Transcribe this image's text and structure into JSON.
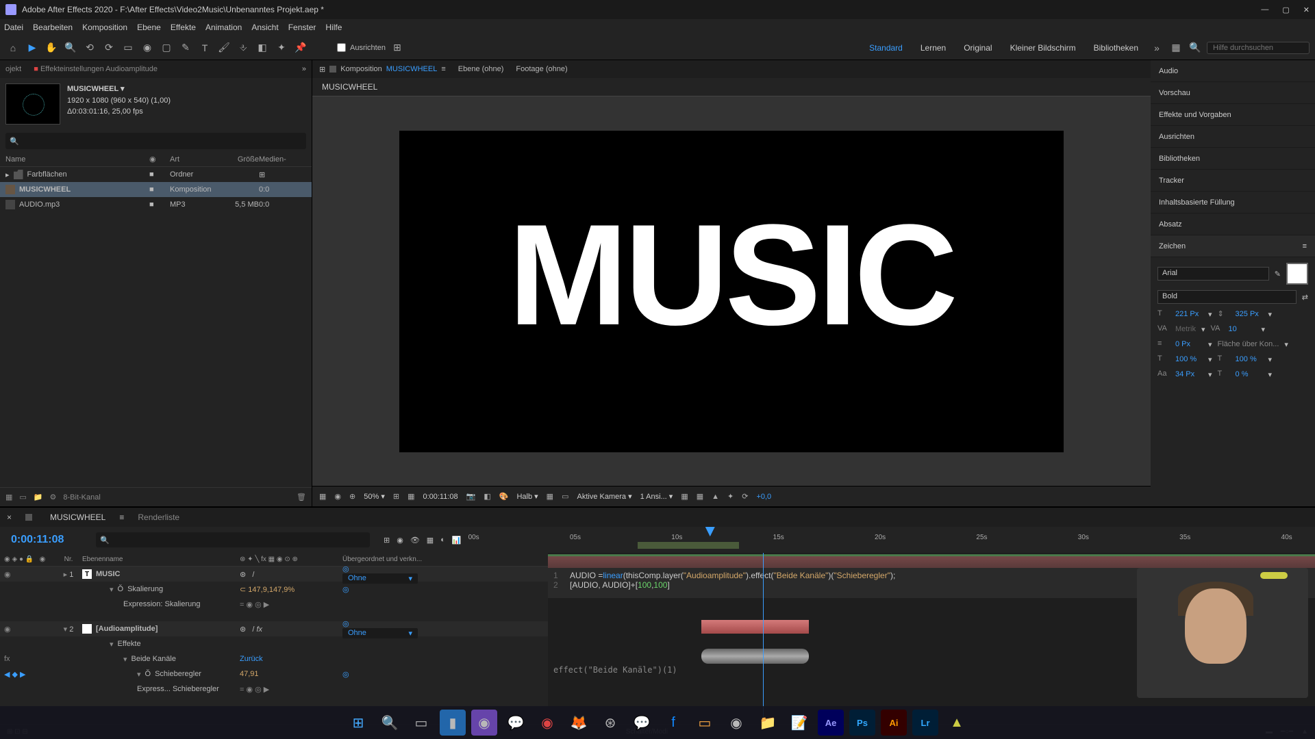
{
  "titlebar": {
    "app": "Adobe After Effects 2020",
    "file": "F:\\After Effects\\Video2Music\\Unbenanntes Projekt.aep *"
  },
  "menu": [
    "Datei",
    "Bearbeiten",
    "Komposition",
    "Ebene",
    "Effekte",
    "Animation",
    "Ansicht",
    "Fenster",
    "Hilfe"
  ],
  "toolbar": {
    "align": "Ausrichten",
    "workspaces": [
      "Standard",
      "Lernen",
      "Original",
      "Kleiner Bildschirm",
      "Bibliotheken"
    ],
    "active_ws": "Standard",
    "search_ph": "Hilfe durchsuchen"
  },
  "left": {
    "tabs": {
      "project": "ojekt",
      "fx": "Effekteinstellungen Audioamplitude"
    },
    "comp_name": "MUSICWHEEL",
    "comp_dims": "1920 x 1080 (960 x 540) (1,00)",
    "comp_dur": "Δ0:03:01:16, 25,00 fps",
    "cols": {
      "name": "Name",
      "type": "Art",
      "size": "Größe",
      "media": "Medien-"
    },
    "rows": [
      {
        "name": "Farbflächen",
        "type": "Ordner",
        "size": "",
        "media": "",
        "kind": "folder"
      },
      {
        "name": "MUSICWHEEL",
        "type": "Komposition",
        "size": "",
        "media": "0:0",
        "kind": "comp",
        "sel": true
      },
      {
        "name": "AUDIO.mp3",
        "type": "MP3",
        "size": "5,5 MB",
        "media": "0:0",
        "kind": "mp3"
      }
    ],
    "footer_depth": "8-Bit-Kanal"
  },
  "center": {
    "tab_comp_label": "Komposition",
    "tab_comp_name": "MUSICWHEEL",
    "tab_layer": "Ebene (ohne)",
    "tab_footage": "Footage (ohne)",
    "subtab": "MUSICWHEEL",
    "viewer_text": "MUSIC",
    "footer": {
      "zoom": "50%",
      "tc": "0:00:11:08",
      "res": "Halb",
      "cam": "Aktive Kamera",
      "views": "1 Ansi...",
      "exp": "+0,0"
    }
  },
  "right": {
    "panels": [
      "Audio",
      "Vorschau",
      "Effekte und Vorgaben",
      "Ausrichten",
      "Bibliotheken",
      "Tracker",
      "Inhaltsbasierte Füllung",
      "Absatz",
      "Zeichen"
    ],
    "char": {
      "font": "Arial",
      "weight": "Bold",
      "size": "221 Px",
      "leading": "325 Px",
      "kerning": "Metrik",
      "tracking": "10",
      "stroke": "0 Px",
      "fill_label": "Fläche über Kon...",
      "hscale": "100 %",
      "vscale": "100 %",
      "baseline": "34 Px",
      "tsume": "0 %"
    }
  },
  "timeline": {
    "tabs": {
      "comp": "MUSICWHEEL",
      "render": "Renderliste"
    },
    "tc": "0:00:11:08",
    "ticks": [
      "00s",
      "05s",
      "10s",
      "15s",
      "20s",
      "25s",
      "30s",
      "35s",
      "40s"
    ],
    "cols": {
      "nr": "Nr.",
      "name": "Ebenenname",
      "parent": "Übergeordnet und verkn..."
    },
    "layers": {
      "l1": {
        "num": "1",
        "name": "MUSIC",
        "mode": "Ohne"
      },
      "scale": {
        "label": "Skalierung",
        "val": "147,9,147,9%"
      },
      "expr": {
        "label": "Expression: Skalierung"
      },
      "l2": {
        "num": "2",
        "name": "[Audioamplitude]",
        "mode": "Ohne"
      },
      "fx": {
        "label": "Effekte"
      },
      "both": {
        "label": "Beide Kanäle",
        "reset": "Zurück"
      },
      "slider": {
        "label": "Schieberegler",
        "val": "47,91"
      },
      "expr2": {
        "label": "Express... Schieberegler"
      }
    },
    "code_line1_pre": "AUDIO =",
    "code_line1_fn": "linear",
    "code_line1_a": "(thisComp.layer(",
    "code_line1_s1": "\"Audioamplitude\"",
    "code_line1_b": ").effect(",
    "code_line1_s2": "\"Beide Kanäle\"",
    "code_line1_c": ")(",
    "code_line1_s3": "\"Schieberegler\"",
    "code_line1_d": ");",
    "code_line2_a": "[AUDIO, AUDIO]+[",
    "code_line2_n1": "100",
    "code_line2_b": ",",
    "code_line2_n2": "100",
    "code_line2_c": "]",
    "expr_audio": "effect(\"Beide Kanäle\")(1)",
    "footer": "Schalter/Modi"
  }
}
